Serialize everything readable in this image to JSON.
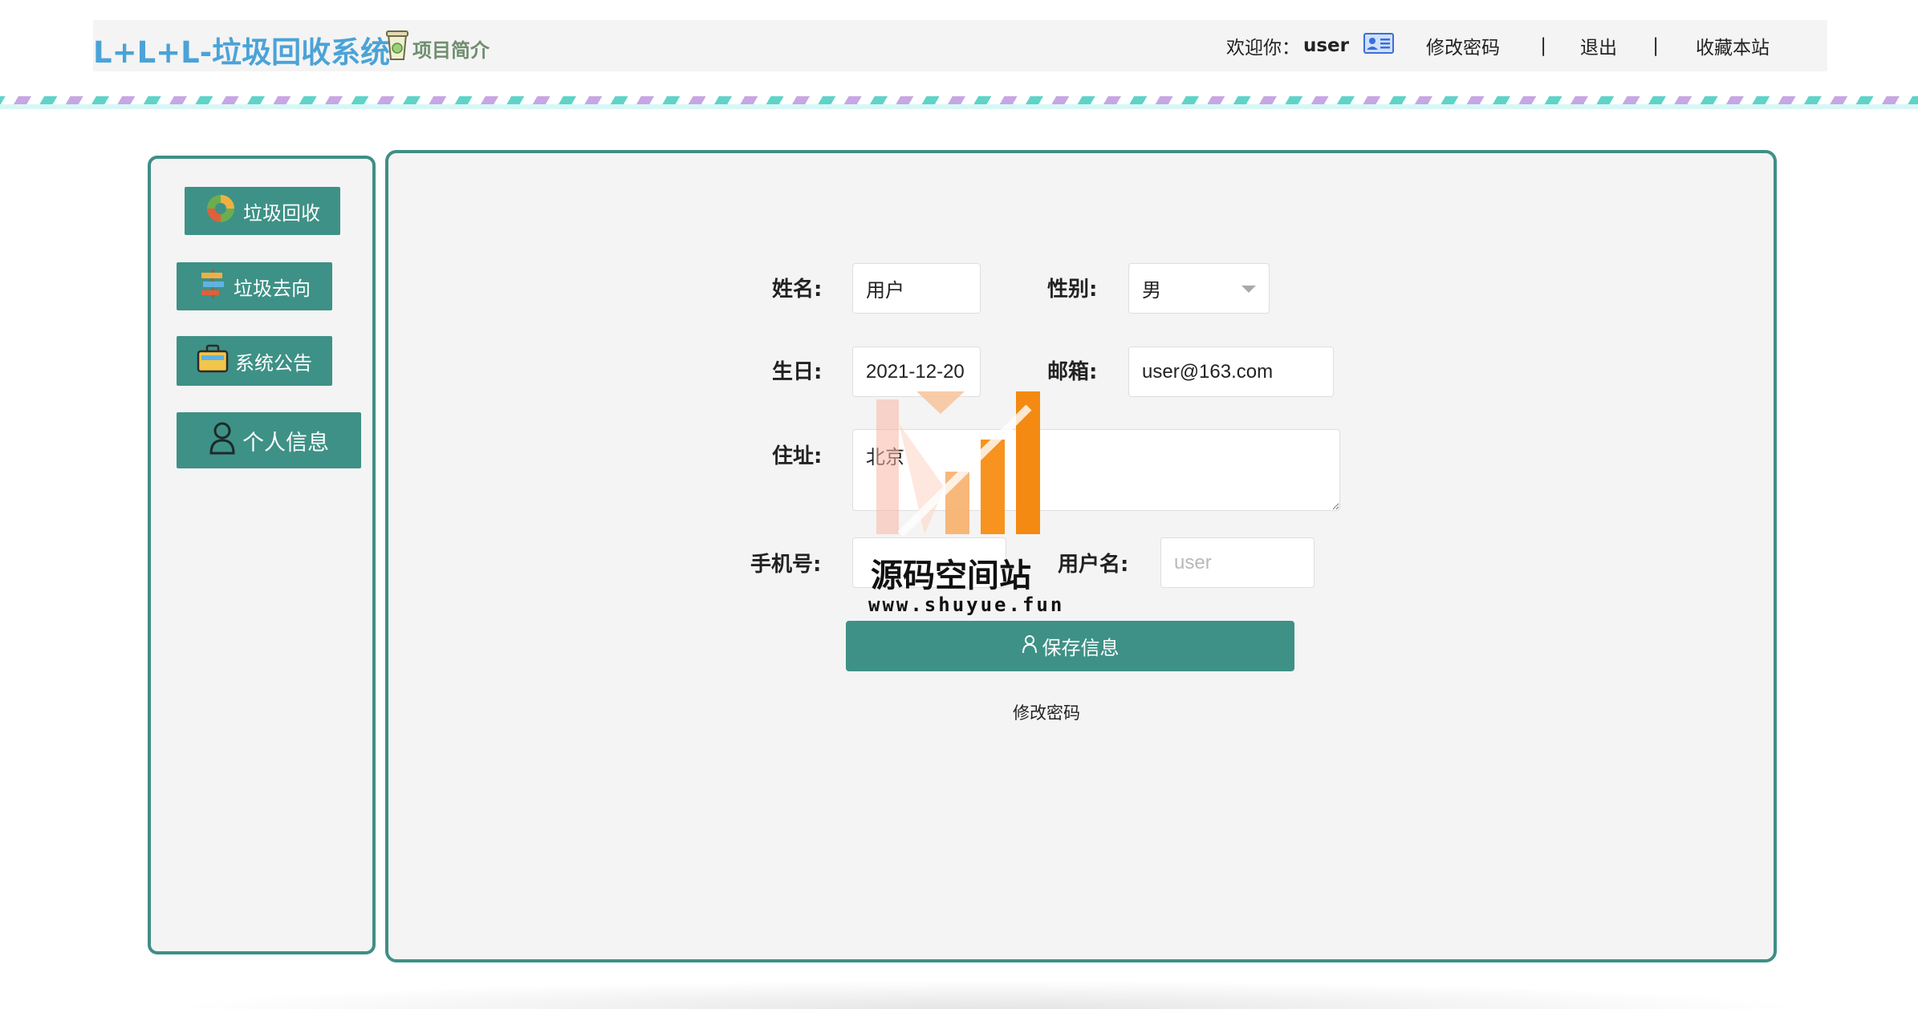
{
  "header": {
    "logo": "L+L+L-垃圾回收系统",
    "intro_label": "项目简介",
    "welcome_label": "欢迎你：",
    "username": "user",
    "change_password": "修改密码",
    "separator": "|",
    "logout": "退出",
    "bookmark": "收藏本站"
  },
  "sidebar": {
    "items": [
      {
        "label": "垃圾回收",
        "icon": "recycle-icon"
      },
      {
        "label": "垃圾去向",
        "icon": "signpost-icon"
      },
      {
        "label": "系统公告",
        "icon": "briefcase-icon"
      },
      {
        "label": "个人信息",
        "icon": "person-icon"
      }
    ]
  },
  "form": {
    "name_label": "姓名:",
    "name_value": "用户",
    "gender_label": "性别:",
    "gender_value": "男",
    "birthday_label": "生日:",
    "birthday_value": "2021-12-20",
    "email_label": "邮箱:",
    "email_value": "user@163.com",
    "address_label": "住址:",
    "address_value": "北京",
    "phone_label": "手机号:",
    "phone_value": "",
    "username_label": "用户名:",
    "username_placeholder": "user",
    "save_label": "保存信息",
    "change_password_link": "修改密码"
  },
  "watermark": {
    "title": "源码空间站",
    "url": "www.shuyue.fun"
  },
  "colors": {
    "primary": "#3e9186",
    "border": "#3f8f86",
    "logo": "#4aa3d8",
    "watermark_orange": "#f7931e"
  }
}
